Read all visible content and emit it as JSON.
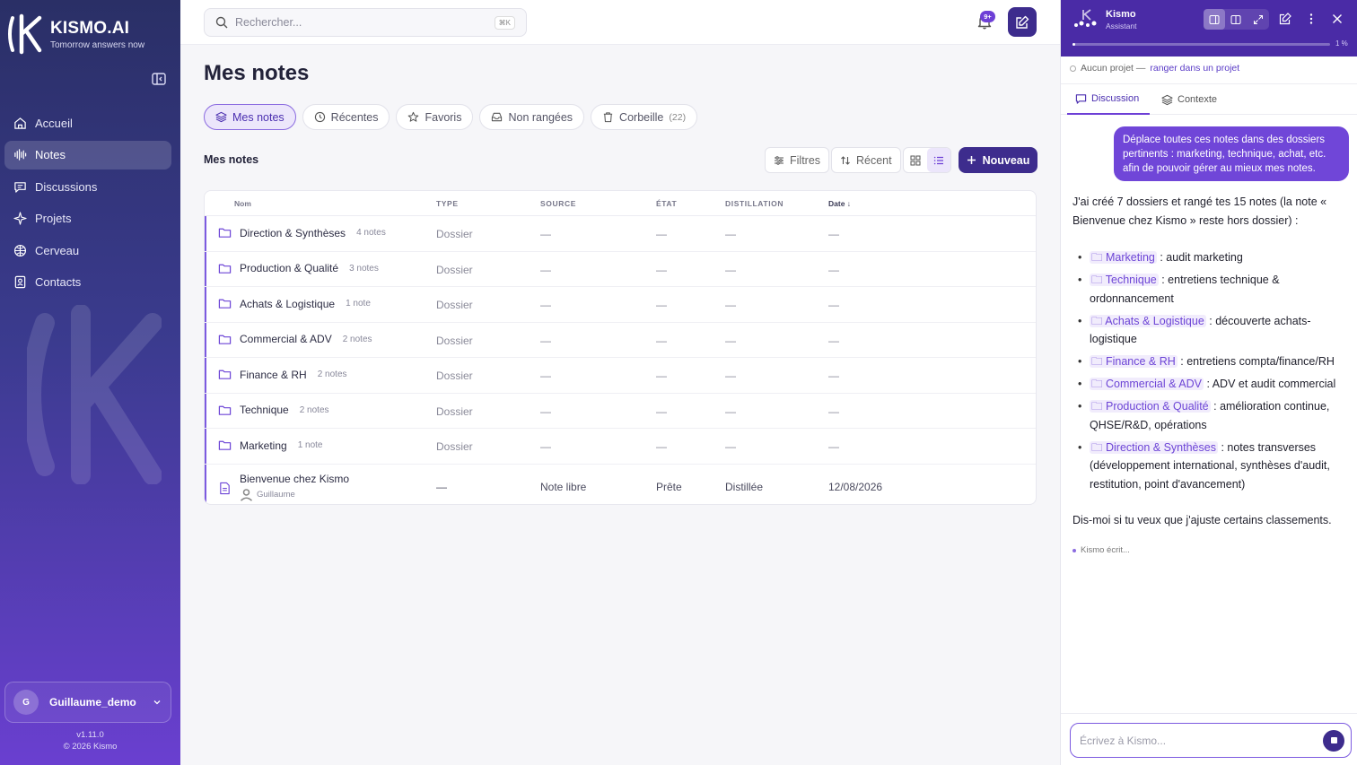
{
  "brand": {
    "name": "KISMO.AI",
    "tagline": "Tomorrow answers now"
  },
  "sidebar": {
    "items": [
      {
        "label": "Accueil",
        "icon": "home-icon"
      },
      {
        "label": "Notes",
        "icon": "waveform-icon",
        "active": true
      },
      {
        "label": "Discussions",
        "icon": "chat-icon"
      },
      {
        "label": "Projets",
        "icon": "sparkle-icon"
      },
      {
        "label": "Cerveau",
        "icon": "brain-icon"
      },
      {
        "label": "Contacts",
        "icon": "contacts-icon"
      }
    ],
    "user": {
      "initial": "G",
      "name": "Guillaume_demo"
    },
    "version": "v1.11.0",
    "copyright": "© 2026 Kismo"
  },
  "topbar": {
    "search_placeholder": "Rechercher...",
    "shortcut": "⌘K",
    "notifications_badge": "9+"
  },
  "page": {
    "title": "Mes notes",
    "tabs": [
      {
        "label": "Mes notes",
        "icon": "layers-icon",
        "active": true
      },
      {
        "label": "Récentes",
        "icon": "clock-icon"
      },
      {
        "label": "Favoris",
        "icon": "star-icon"
      },
      {
        "label": "Non rangées",
        "icon": "inbox-icon"
      },
      {
        "label": "Corbeille",
        "icon": "trash-icon",
        "count": "(22)"
      }
    ],
    "section_label": "Mes notes",
    "toolbar": {
      "filters": "Filtres",
      "sort": "Récent",
      "new": "Nouveau"
    }
  },
  "table": {
    "columns": [
      "Nom",
      "TYPE",
      "SOURCE",
      "ÉTAT",
      "DISTILLATION",
      "Date"
    ],
    "rows": [
      {
        "name": "Direction & Synthèses",
        "count": "4 notes",
        "type": "Dossier",
        "source": "—",
        "state": "—",
        "distillation": "—",
        "date": "—"
      },
      {
        "name": "Production & Qualité",
        "count": "3 notes",
        "type": "Dossier",
        "source": "—",
        "state": "—",
        "distillation": "—",
        "date": "—"
      },
      {
        "name": "Achats & Logistique",
        "count": "1 note",
        "type": "Dossier",
        "source": "—",
        "state": "—",
        "distillation": "—",
        "date": "—"
      },
      {
        "name": "Commercial & ADV",
        "count": "2 notes",
        "type": "Dossier",
        "source": "—",
        "state": "—",
        "distillation": "—",
        "date": "—"
      },
      {
        "name": "Finance & RH",
        "count": "2 notes",
        "type": "Dossier",
        "source": "—",
        "state": "—",
        "distillation": "—",
        "date": "—"
      },
      {
        "name": "Technique",
        "count": "2 notes",
        "type": "Dossier",
        "source": "—",
        "state": "—",
        "distillation": "—",
        "date": "—"
      },
      {
        "name": "Marketing",
        "count": "1 note",
        "type": "Dossier",
        "source": "—",
        "state": "—",
        "distillation": "—",
        "date": "—"
      }
    ],
    "note": {
      "name": "Bienvenue chez Kismo",
      "author": "Guillaume",
      "type": "—",
      "source": "Note libre",
      "state": "Prête",
      "distillation": "Distillée",
      "date": "12/08/2026"
    }
  },
  "assistant": {
    "title": "Kismo",
    "subtitle": "Assistant",
    "progress_label": "1 %",
    "progress": 0.01,
    "project_none": "Aucun projet —",
    "project_link": "ranger dans un projet",
    "tabs": [
      "Discussion",
      "Contexte"
    ],
    "user_message": "Déplace toutes ces notes dans des dossiers pertinents : marketing, technique, achat, etc. afin de pouvoir gérer au mieux mes notes.",
    "reply_intro": "J'ai créé 7 dossiers et rangé tes 15 notes (la note « Bienvenue chez Kismo » reste hors dossier) :",
    "reply_items": [
      {
        "folder": "Marketing",
        "desc": ": audit marketing"
      },
      {
        "folder": "Technique",
        "desc": ": entretiens technique & ordonnancement"
      },
      {
        "folder": "Achats & Logistique",
        "desc": ": découverte achats-logistique"
      },
      {
        "folder": "Finance & RH",
        "desc": ": entretiens compta/finance/RH"
      },
      {
        "folder": "Commercial & ADV",
        "desc": ": ADV et audit commercial"
      },
      {
        "folder": "Production & Qualité",
        "desc": ": amélioration continue, QHSE/R&D, opérations"
      },
      {
        "folder": "Direction & Synthèses",
        "desc": ": notes transverses (développement international, synthèses d'audit, restitution, point d'avancement)"
      }
    ],
    "reply_outro": "Dis-moi si tu veux que j'ajuste certains classements.",
    "typing": "Kismo écrit...",
    "input_placeholder": "Écrivez à Kismo..."
  },
  "colors": {
    "accent": "#6d3fd6",
    "primary_dark": "#3d2c8d",
    "header": "#4a2ba6"
  }
}
